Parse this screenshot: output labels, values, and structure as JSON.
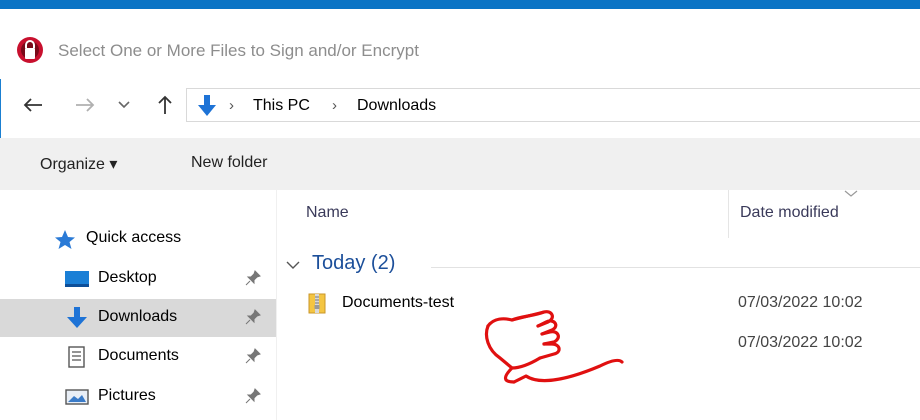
{
  "window": {
    "title": "Select One or More Files to Sign and/or Encrypt",
    "accent_color": "#0b74c5"
  },
  "navigation": {
    "back_icon": "arrow-left-icon",
    "forward_icon": "arrow-right-icon",
    "recent_icon": "chevron-down-icon",
    "up_icon": "arrow-up-icon"
  },
  "address_bar": {
    "location_icon": "downloads-icon",
    "breadcrumbs": [
      "This PC",
      "Downloads"
    ]
  },
  "command_bar": {
    "organize_label": "Organize ▾",
    "new_folder_label": "New folder"
  },
  "nav_pane": {
    "items": [
      {
        "label": "Quick access",
        "icon": "star-icon"
      },
      {
        "label": "Desktop",
        "icon": "desktop-icon",
        "pinned": true
      },
      {
        "label": "Downloads",
        "icon": "downloads-icon",
        "pinned": true,
        "selected": true
      },
      {
        "label": "Documents",
        "icon": "documents-icon",
        "pinned": true
      },
      {
        "label": "Pictures",
        "icon": "pictures-icon",
        "pinned": true
      }
    ]
  },
  "file_list": {
    "columns": [
      "Name",
      "Date modified"
    ],
    "group_header": "Today (2)",
    "files": [
      {
        "name": "Documents-test",
        "date": "07/03/2022 10:02",
        "icon": "zip-folder-icon"
      },
      {
        "name": "",
        "date": "07/03/2022 10:02"
      }
    ]
  },
  "overlay": {
    "icon": "pointing-hand-icon",
    "color": "#e01010"
  }
}
